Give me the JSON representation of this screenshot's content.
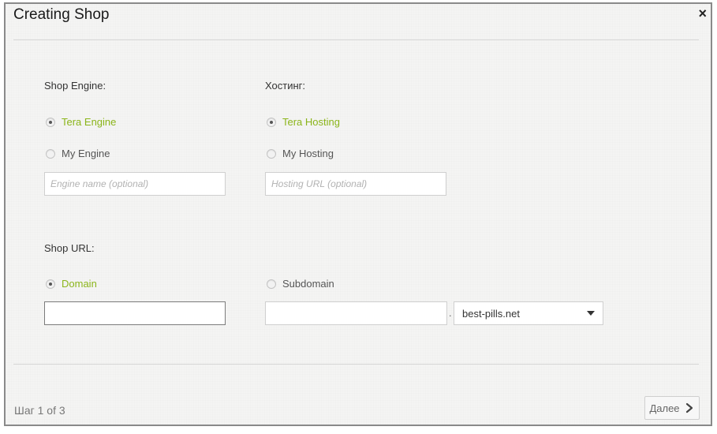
{
  "dialog": {
    "title": "Creating Shop",
    "close_glyph": "×"
  },
  "engine": {
    "label": "Shop Engine:",
    "option_tera": "Tera Engine",
    "option_my": "My Engine",
    "selected": "tera",
    "name_placeholder": "Engine name (optional)"
  },
  "hosting": {
    "label": "Хостинг:",
    "option_tera": "Tera Hosting",
    "option_my": "My Hosting",
    "selected": "tera",
    "url_placeholder": "Hosting URL (optional)"
  },
  "url": {
    "label": "Shop URL:",
    "option_domain": "Domain",
    "option_subdomain": "Subdomain",
    "selected": "domain",
    "domain_value": "",
    "subdomain_value": "",
    "separator": ".",
    "subdomain_select": "best-pills.net"
  },
  "footer": {
    "step_text": "Шаг 1 of 3",
    "next_label": "Далее",
    "next_icon": "chevron-right-icon"
  },
  "colors": {
    "accent": "#8bb51a",
    "border": "#8a8a8a"
  }
}
